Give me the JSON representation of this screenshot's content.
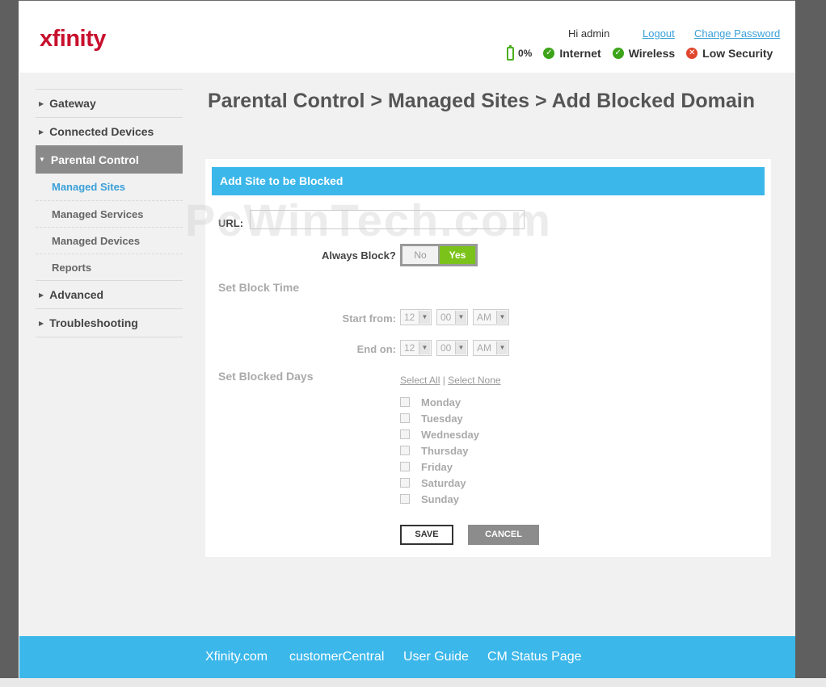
{
  "header": {
    "logo": "xfinity",
    "greeting": "Hi admin",
    "logout": "Logout",
    "change_password": "Change Password",
    "battery": "0%",
    "internet": "Internet",
    "wireless": "Wireless",
    "security": "Low Security"
  },
  "nav": {
    "gateway": "Gateway",
    "connected_devices": "Connected Devices",
    "parental_control": "Parental Control",
    "managed_sites": "Managed Sites",
    "managed_services": "Managed Services",
    "managed_devices": "Managed Devices",
    "reports": "Reports",
    "advanced": "Advanced",
    "troubleshooting": "Troubleshooting"
  },
  "page_title": "Parental Control > Managed Sites > Add Blocked Domain",
  "form": {
    "heading": "Add Site to be Blocked",
    "url_label": "URL:",
    "url_value": "",
    "always_block_label": "Always Block?",
    "toggle_no": "No",
    "toggle_yes": "Yes",
    "set_block_time": "Set Block Time",
    "start_from_label": "Start from:",
    "end_on_label": "End on:",
    "start_hour": "12",
    "start_min": "00",
    "start_ampm": "AM",
    "end_hour": "12",
    "end_min": "00",
    "end_ampm": "AM",
    "set_blocked_days": "Set Blocked Days",
    "select_all": "Select All",
    "separator": "|",
    "select_none": "Select None",
    "days": [
      "Monday",
      "Tuesday",
      "Wednesday",
      "Thursday",
      "Friday",
      "Saturday",
      "Sunday"
    ],
    "save": "SAVE",
    "cancel": "CANCEL"
  },
  "watermark": "PcWinTech.com",
  "footer": {
    "xfinity": "Xfinity.com",
    "customer_central": "customerCentral",
    "user_guide": "User Guide",
    "cm_status": "CM Status Page"
  },
  "colors": {
    "accent": "#3bb7ea",
    "toggle_on": "#7bc31a",
    "logo": "#c8102e",
    "status_ok": "#3da41a",
    "status_bad": "#e0452e"
  }
}
